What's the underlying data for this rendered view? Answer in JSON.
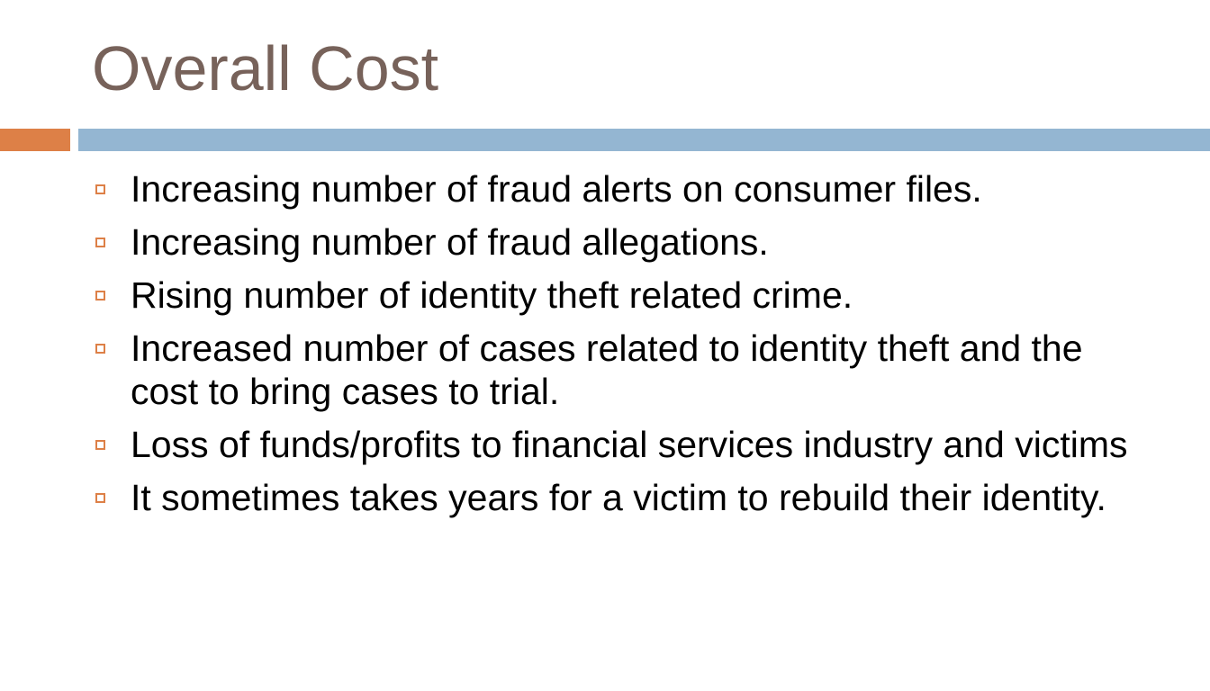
{
  "slide": {
    "title": "Overall Cost",
    "colors": {
      "title": "#77625A",
      "accent": "#DD8047",
      "rule": "#94B6D2",
      "bullet_marker": "#DD8047"
    },
    "bullets": [
      {
        "icon": "hollow-square-icon",
        "text": "Increasing number of fraud alerts on consumer files."
      },
      {
        "icon": "hollow-square-icon",
        "text": "Increasing number of fraud allegations."
      },
      {
        "icon": "hollow-square-icon",
        "text": "Rising number of identity theft related crime."
      },
      {
        "icon": "hollow-square-icon",
        "text": "Increased number of cases related to identity theft and the cost to bring cases to trial."
      },
      {
        "icon": "hollow-square-icon",
        "text": "Loss of funds/profits to financial services industry and victims"
      },
      {
        "icon": "hollow-square-icon",
        "text": "It sometimes takes years for a victim to rebuild their identity."
      }
    ]
  }
}
